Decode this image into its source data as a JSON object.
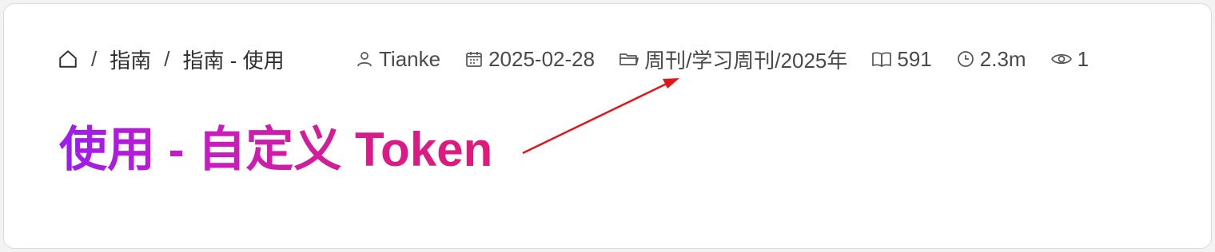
{
  "breadcrumb": {
    "items": [
      "指南",
      "指南 - 使用"
    ],
    "separator": "/"
  },
  "meta": {
    "author": "Tianke",
    "date": "2025-02-28",
    "category": "周刊/学习周刊/2025年",
    "word_count": "591",
    "reading_time": "2.3m",
    "views": "1"
  },
  "title": "使用 - 自定义 Token",
  "colors": {
    "title_gradient_start": "#9b1cf0",
    "title_gradient_end": "#e0197a",
    "annotation_arrow": "#e3141b"
  }
}
